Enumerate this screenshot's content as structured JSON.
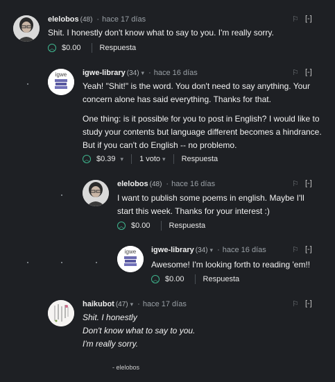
{
  "comments": [
    {
      "author": "elelobos",
      "rep": "(48)",
      "time": "hace 17 días",
      "flag": "⚐",
      "collapse": "[-]",
      "body": [
        "Shit. I honestly don't know what to say to you. I'm really sorry."
      ],
      "payout": "$0.00",
      "reply": "Respuesta"
    },
    {
      "author": "igwe-library",
      "rep": "(34)",
      "time": "hace 16 días",
      "flag": "⚐",
      "collapse": "[-]",
      "avatar_text": "igwe",
      "body": [
        "Yeah! \"Shit!\" is the word. You don't need to say anything. Your concern alone has said everything. Thanks for that.",
        "One thing: is it possible for you to post in English? I would like to study your contents but language different becomes a hindrance. But if you can't do English -- no problemo."
      ],
      "payout": "$0.39",
      "votes": "1 voto",
      "reply": "Respuesta"
    },
    {
      "author": "elelobos",
      "rep": "(48)",
      "time": "hace 16 días",
      "flag": "⚐",
      "collapse": "[-]",
      "body": [
        "I want to publish some poems in english. Maybe I'll start this week. Thanks for your interest :)"
      ],
      "payout": "$0.00",
      "reply": "Respuesta"
    },
    {
      "author": "igwe-library",
      "rep": "(34)",
      "time": "hace 16 días",
      "flag": "⚐",
      "collapse": "[-]",
      "avatar_text": "igwe",
      "body": [
        "Awesome! I'm looking forth to reading 'em!!"
      ],
      "payout": "$0.00",
      "reply": "Respuesta"
    },
    {
      "author": "haikubot",
      "rep": "(47)",
      "time": "hace 17 días",
      "flag": "⚐",
      "collapse": "[-]",
      "poem": [
        "Shit. I honestly",
        "Don't know what to say to you.",
        "I'm really sorry."
      ],
      "signature": "- elelobos"
    }
  ],
  "icons": {
    "upvote": "upvote-icon",
    "caret": "chevron-down-icon",
    "flag": "flag-icon"
  },
  "colors": {
    "background": "#1e2024",
    "upvote": "#3fb58e"
  }
}
